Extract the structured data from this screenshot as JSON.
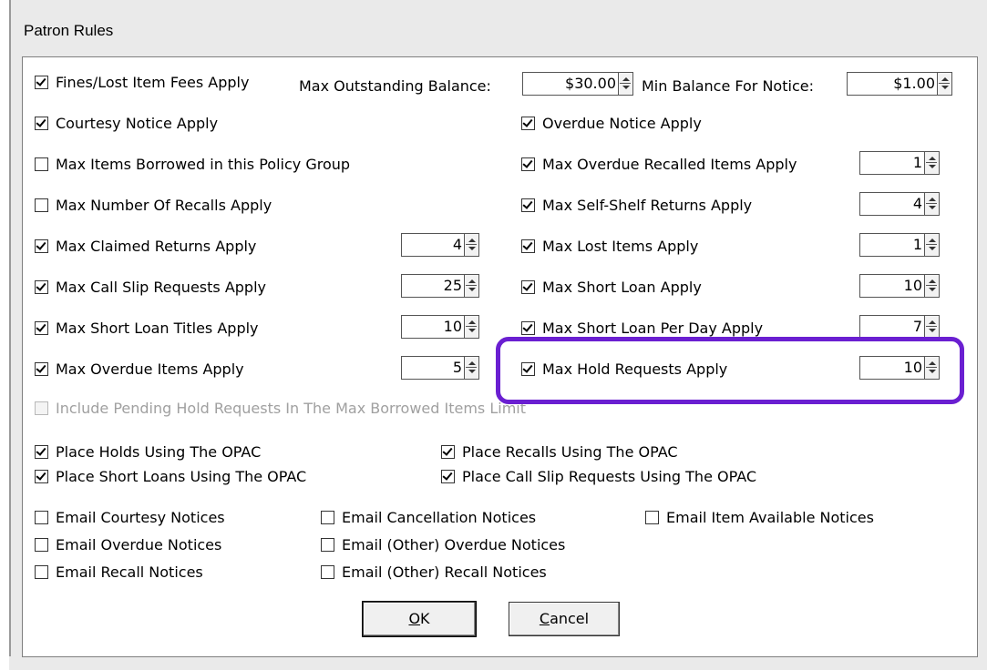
{
  "window": {
    "title": "Patron Rules"
  },
  "top_row": {
    "fines_label": "Fines/Lost Item Fees Apply",
    "fines_checked": true,
    "max_outstanding_label": "Max Outstanding Balance:",
    "max_outstanding_value": "$30.00",
    "min_balance_label": "Min Balance For Notice:",
    "min_balance_value": "$1.00"
  },
  "left_rules": [
    {
      "label": "Courtesy Notice Apply",
      "checked": true,
      "value": null
    },
    {
      "label": "Max Items Borrowed in this Policy Group",
      "checked": false,
      "value": null
    },
    {
      "label": "Max Number Of Recalls Apply",
      "checked": false,
      "value": null
    },
    {
      "label": "Max Claimed Returns Apply",
      "checked": true,
      "value": "4"
    },
    {
      "label": "Max Call Slip Requests Apply",
      "checked": true,
      "value": "25"
    },
    {
      "label": "Max Short Loan Titles Apply",
      "checked": true,
      "value": "10"
    },
    {
      "label": "Max Overdue Items Apply",
      "checked": true,
      "value": "5"
    }
  ],
  "right_rules": [
    {
      "label": "Overdue Notice Apply",
      "checked": true,
      "value": null
    },
    {
      "label": "Max Overdue Recalled Items Apply",
      "checked": true,
      "value": "1"
    },
    {
      "label": "Max Self-Shelf Returns Apply",
      "checked": true,
      "value": "4"
    },
    {
      "label": "Max Lost Items Apply",
      "checked": true,
      "value": "1"
    },
    {
      "label": "Max Short Loan Apply",
      "checked": true,
      "value": "10"
    },
    {
      "label": "Max Short Loan Per Day Apply",
      "checked": true,
      "value": "7"
    },
    {
      "label": "Max Hold Requests Apply",
      "checked": true,
      "value": "10"
    }
  ],
  "include_pending": {
    "label": "Include Pending Hold Requests In The Max Borrowed Items Limit",
    "checked": false,
    "disabled": true
  },
  "opac": [
    {
      "label": "Place Holds Using The OPAC",
      "checked": true
    },
    {
      "label": "Place Recalls Using The OPAC",
      "checked": true
    },
    {
      "label": "Place Short Loans Using The OPAC",
      "checked": true
    },
    {
      "label": "Place Call Slip Requests Using The OPAC",
      "checked": true
    }
  ],
  "email": [
    {
      "label": "Email Courtesy Notices",
      "checked": false
    },
    {
      "label": "Email Cancellation Notices",
      "checked": false
    },
    {
      "label": "Email Item Available Notices",
      "checked": false
    },
    {
      "label": "Email Overdue Notices",
      "checked": false
    },
    {
      "label": "Email (Other) Overdue Notices",
      "checked": false
    },
    {
      "label": "Email Recall Notices",
      "checked": false
    },
    {
      "label": "Email (Other) Recall Notices",
      "checked": false
    }
  ],
  "buttons": {
    "ok_mnemonic": "O",
    "ok_rest": "K",
    "cancel_mnemonic": "C",
    "cancel_rest": "ancel"
  },
  "colors": {
    "highlight": "#6a1fd1"
  }
}
